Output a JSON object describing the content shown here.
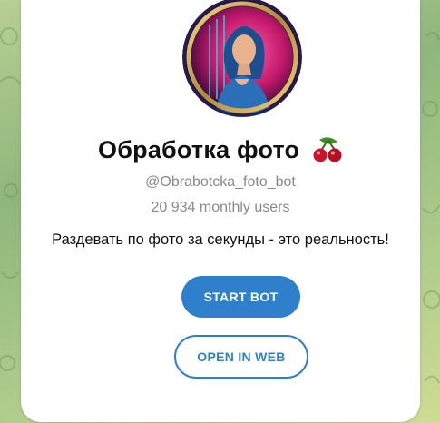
{
  "bot": {
    "name": "Обработка фото",
    "name_emoji": "cherries-icon",
    "handle": "@Obrabotcka_foto_bot",
    "monthly_users": "20 934 monthly users",
    "description": "Раздевать по фото за секунды - это реальность!"
  },
  "actions": {
    "start_label": "START BOT",
    "web_label": "OPEN IN WEB"
  },
  "colors": {
    "accent": "#2f80cc",
    "background_green": "#9fc283"
  }
}
